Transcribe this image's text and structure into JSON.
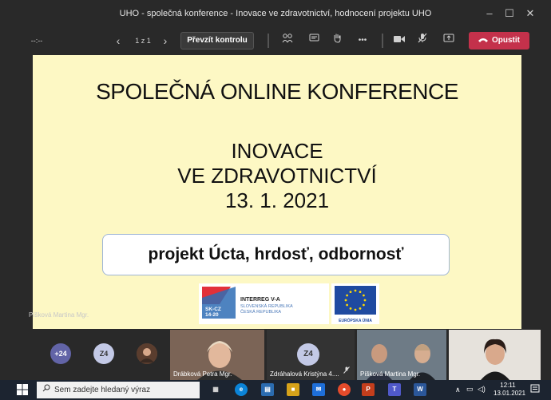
{
  "window": {
    "title": "UHO - společná konference - Inovace ve zdravotnictví, hodnocení projektu UHO",
    "minimize": "–",
    "maximize": "☐",
    "close": "✕"
  },
  "toolbar": {
    "timer": "--:--",
    "page_indicator": "1 z 1",
    "take_control_label": "Převzít kontrolu",
    "more": "•••",
    "leave_label": "Opustit"
  },
  "slide": {
    "title_line": "SPOLEČNÁ ONLINE KONFERENCE",
    "line1": "INOVACE",
    "line2": "VE ZDRAVOTNICTVÍ",
    "line3": "13. 1. 2021",
    "project_box": "projekt Úcta, hrdosť, odbornosť",
    "interreg_title": "INTERREG V-A",
    "interreg_l1": "SLOVENSKÁ REPUBLIKA",
    "interreg_l2": "ČESKÁ REPUBLIKA",
    "interreg_code1": "SK-CZ",
    "interreg_code2": "14-20",
    "eu_label": "EURÓPSKA ÚNIA",
    "speaker_name": "Píšková Martina Mgr."
  },
  "participants": {
    "overflow_count": "+24",
    "initials_1": "Z4",
    "tile_1_name": "Drábková Petra Mgr.",
    "tile_2_initials": "Z4",
    "tile_2_name": "Zdráhalová Kristýna 4....",
    "tile_3_name": "Píšková Martina Mgr."
  },
  "taskbar": {
    "search_placeholder": "Sem zadejte hledaný výraz",
    "time": "12:11",
    "date": "13.01.2021",
    "colors": {
      "accent_red": "#c4314b",
      "slide_bg": "#fdf8c4"
    }
  }
}
